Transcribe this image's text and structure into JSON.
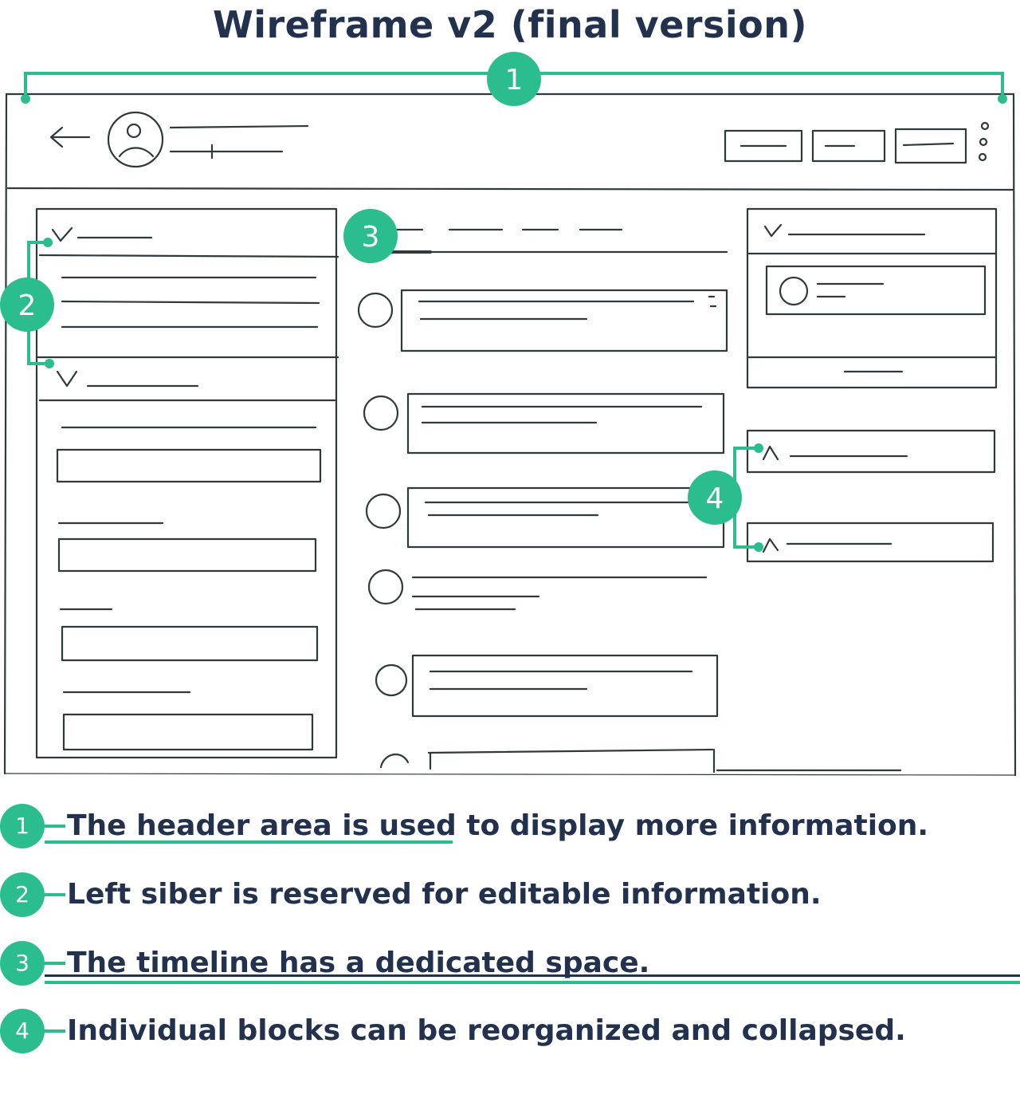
{
  "title": "Wireframe v2 (final version)",
  "colors": {
    "accent": "#2bbd8d",
    "text_dark": "#22314e",
    "sketch": "#2f3a3a"
  },
  "markers": [
    "1",
    "2",
    "3",
    "4"
  ],
  "legend": [
    {
      "number": "1",
      "text": "The header area is used to display more information."
    },
    {
      "number": "2",
      "text": "Left siber is reserved for editable information."
    },
    {
      "number": "3",
      "text": "The timeline has a dedicated space."
    },
    {
      "number": "4",
      "text": "Individual blocks can be reorganized and collapsed."
    }
  ]
}
